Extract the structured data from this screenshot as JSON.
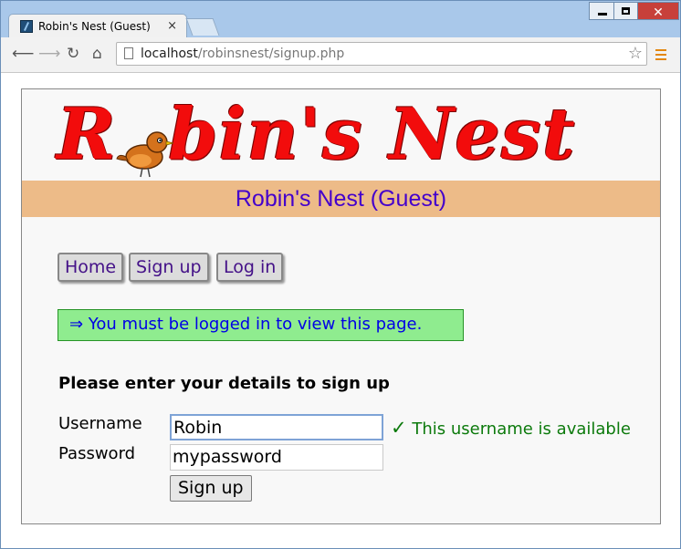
{
  "browser": {
    "tab_title": "Robin's Nest (Guest)",
    "tab_close": "×",
    "url_host": "localhost",
    "url_path": "/robinsnest/signup.php"
  },
  "site": {
    "logo_text": "Robin's Nest",
    "banner": "Robin's Nest (Guest)",
    "nav": [
      "Home",
      "Sign up",
      "Log in"
    ],
    "notice": "⇒ You must be logged in to view this page.",
    "form": {
      "heading": "Please enter your details to sign up",
      "username_label": "Username",
      "password_label": "Password",
      "username_value": "Robin",
      "password_value": "mypassword",
      "availability": "This username is available",
      "check": "✓",
      "submit_label": "Sign up"
    }
  },
  "colors": {
    "banner_bg": "#edbb88",
    "banner_text": "#4400cc",
    "notice_bg": "#8fec8f",
    "logo_red": "#f20c0c",
    "available_green": "#0c7a0c"
  }
}
